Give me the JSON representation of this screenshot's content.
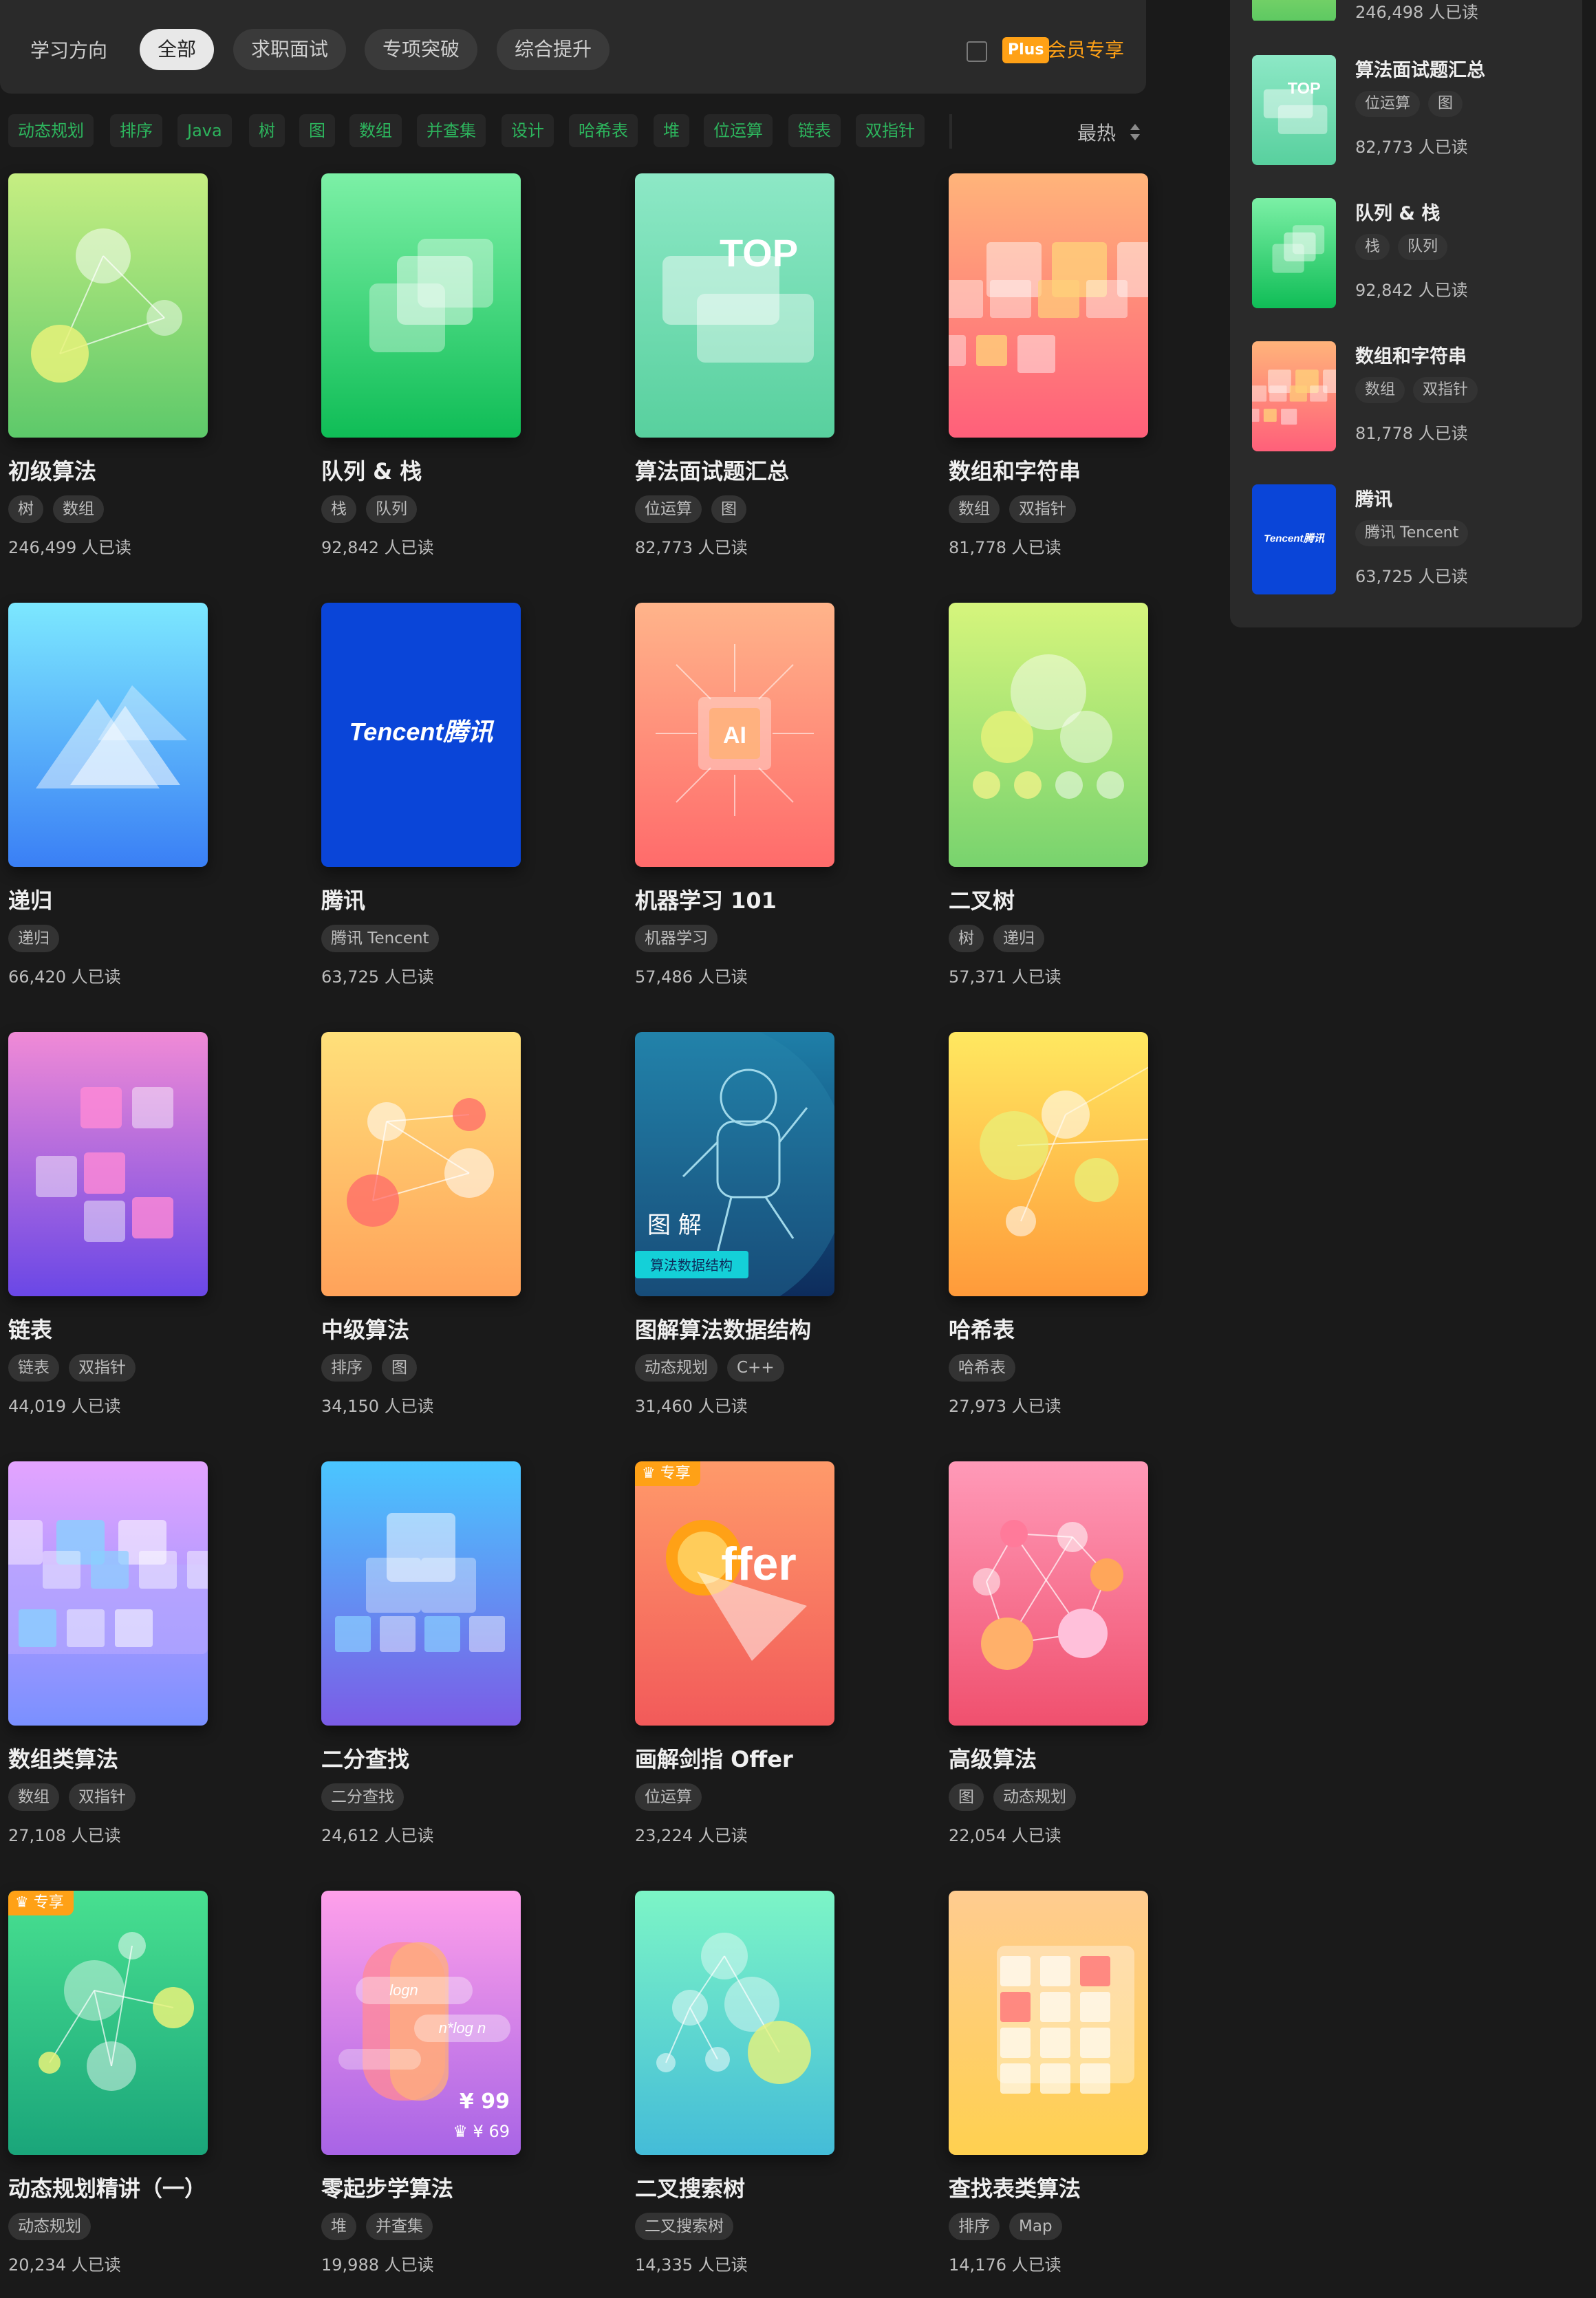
{
  "filter": {
    "label": "学习方向",
    "pills": [
      "全部",
      "求职面试",
      "专项突破",
      "综合提升"
    ],
    "active_index": 0,
    "plus_badge": "Plus",
    "plus_text": "会员专享",
    "plus_checked": false
  },
  "tag_filters": [
    "动态规划",
    "排序",
    "Java",
    "树",
    "图",
    "数组",
    "并查集",
    "设计",
    "哈希表",
    "堆",
    "位运算",
    "链表",
    "双指针"
  ],
  "sort": {
    "label": "最热"
  },
  "cards": [
    {
      "title": "初级算法",
      "tags": [
        "树",
        "数组"
      ],
      "reads": "246,499 人已读",
      "cover": "green-nodes"
    },
    {
      "title": "队列 & 栈",
      "tags": [
        "栈",
        "队列"
      ],
      "reads": "92,842 人已读",
      "cover": "green-layers"
    },
    {
      "title": "算法面试题汇总",
      "tags": [
        "位运算",
        "图"
      ],
      "reads": "82,773 人已读",
      "cover": "top",
      "cover_text": "TOP"
    },
    {
      "title": "数组和字符串",
      "tags": [
        "数组",
        "双指针"
      ],
      "reads": "81,778 人已读",
      "cover": "red-grid"
    },
    {
      "title": "递归",
      "tags": [
        "递归"
      ],
      "reads": "66,420 人已读",
      "cover": "blue-mountain"
    },
    {
      "title": "腾讯",
      "tags": [
        "腾讯 Tencent"
      ],
      "reads": "63,725 人已读",
      "cover": "tencent",
      "cover_text": "Tencent腾讯"
    },
    {
      "title": "机器学习 101",
      "tags": [
        "机器学习"
      ],
      "reads": "57,486 人已读",
      "cover": "ai-chip",
      "cover_text": "AI"
    },
    {
      "title": "二叉树",
      "tags": [
        "树",
        "递归"
      ],
      "reads": "57,371 人已读",
      "cover": "green-tree"
    },
    {
      "title": "链表",
      "tags": [
        "链表",
        "双指针"
      ],
      "reads": "44,019 人已读",
      "cover": "purple-list"
    },
    {
      "title": "中级算法",
      "tags": [
        "排序",
        "图"
      ],
      "reads": "34,150 人已读",
      "cover": "orange-nodes"
    },
    {
      "title": "图解算法数据结构",
      "tags": [
        "动态规划",
        "C++"
      ],
      "reads": "31,460 人已读",
      "cover": "astronaut",
      "cover_text": "图 解",
      "cover_sub": "算法数据结构"
    },
    {
      "title": "哈希表",
      "tags": [
        "哈希表"
      ],
      "reads": "27,973 人已读",
      "cover": "yellow-hash"
    },
    {
      "title": "数组类算法",
      "tags": [
        "数组",
        "双指针"
      ],
      "reads": "27,108 人已读",
      "cover": "violet-array"
    },
    {
      "title": "二分查找",
      "tags": [
        "二分查找"
      ],
      "reads": "24,612 人已读",
      "cover": "blue-binary"
    },
    {
      "title": "画解剑指 Offer",
      "tags": [
        "位运算"
      ],
      "reads": "23,224 人已读",
      "cover": "offer",
      "cover_text": "ffer",
      "badge": "专享"
    },
    {
      "title": "高级算法",
      "tags": [
        "图",
        "动态规划"
      ],
      "reads": "22,054 人已读",
      "cover": "pink-graph"
    },
    {
      "title": "动态规划精讲（一）",
      "tags": [
        "动态规划"
      ],
      "reads": "20,234 人已读",
      "cover": "green-dp",
      "badge": "专享"
    },
    {
      "title": "零起步学算法",
      "tags": [
        "堆",
        "并查集"
      ],
      "reads": "19,988 人已读",
      "cover": "pink-logn",
      "cover_text": "logn",
      "cover_sub": "n*log n",
      "price": "¥ 99",
      "vip_price": "¥ 69"
    },
    {
      "title": "二叉搜索树",
      "tags": [
        "二叉搜索树"
      ],
      "reads": "14,335 人已读",
      "cover": "teal-bst"
    },
    {
      "title": "查找表类算法",
      "tags": [
        "排序",
        "Map"
      ],
      "reads": "14,176 人已读",
      "cover": "yellow-table"
    }
  ],
  "side": {
    "partial_reads": "246,498 人已读",
    "items": [
      {
        "title": "算法面试题汇总",
        "tags": [
          "位运算",
          "图"
        ],
        "reads": "82,773 人已读",
        "cover": "top",
        "cover_text": "TOP"
      },
      {
        "title": "队列 & 栈",
        "tags": [
          "栈",
          "队列"
        ],
        "reads": "92,842 人已读",
        "cover": "green-layers"
      },
      {
        "title": "数组和字符串",
        "tags": [
          "数组",
          "双指针"
        ],
        "reads": "81,778 人已读",
        "cover": "red-grid"
      },
      {
        "title": "腾讯",
        "tags": [
          "腾讯 Tencent"
        ],
        "reads": "63,725 人已读",
        "cover": "tencent",
        "cover_text": "Tencent腾讯"
      }
    ]
  },
  "colors": {
    "background": "#1a1a1a",
    "panel": "#2a2a2a",
    "accent_orange": "#ffa116",
    "tag_green": "#2db55d"
  }
}
